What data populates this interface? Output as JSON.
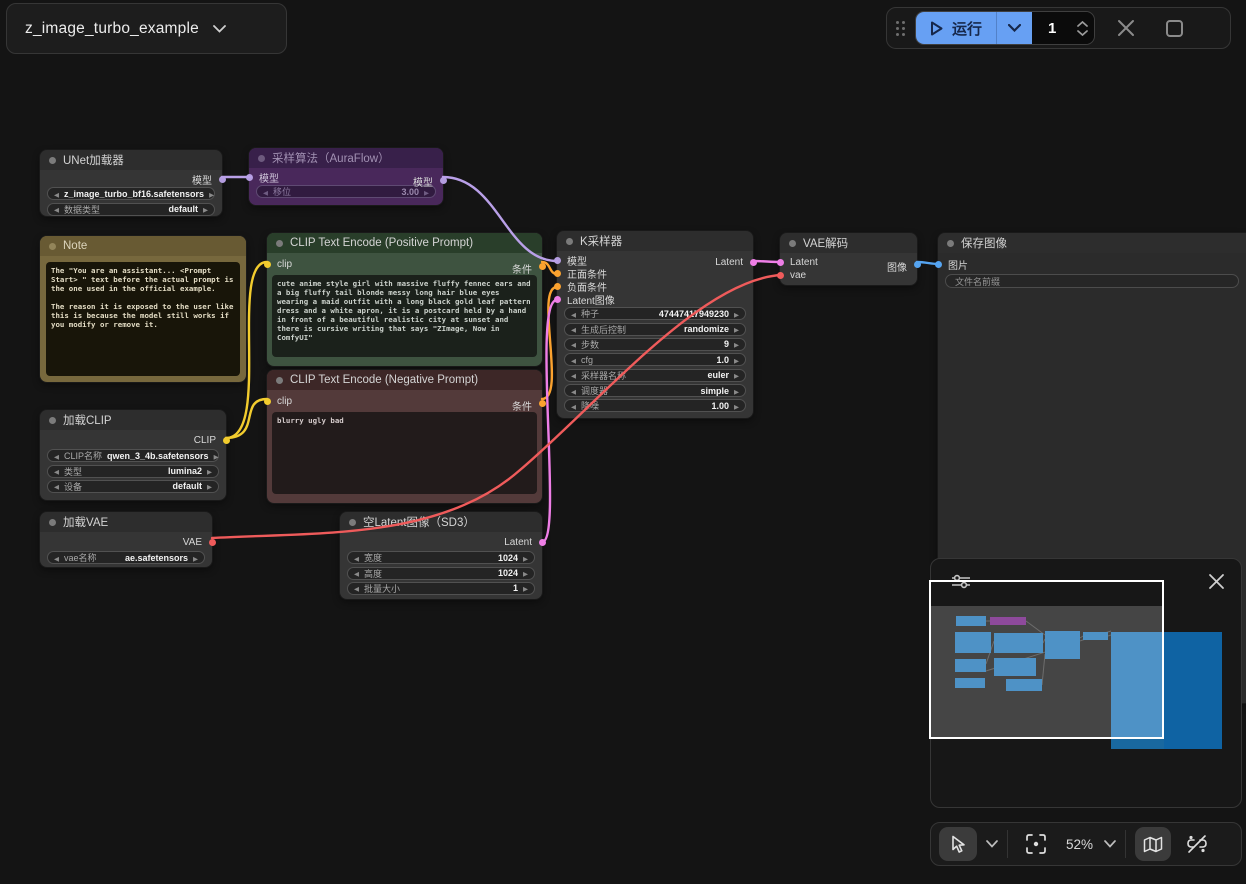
{
  "workflow_tab": {
    "title": "z_image_turbo_example"
  },
  "topbar": {
    "run_label": "运行",
    "batch_count": "1"
  },
  "bottombar": {
    "zoom_level": "52%"
  },
  "colors": {
    "accent_blue": "#67a0f3",
    "wire_model": "#b9a0e8",
    "wire_cond": "#fba22f",
    "wire_clip": "#f2cc2e",
    "wire_latent": "#ee7ee6",
    "wire_vae": "#ef5b5b",
    "wire_image": "#55a4f1",
    "node_green": "#3e5340",
    "node_maroon": "#533a3a",
    "node_olive": "#77683d",
    "node_purple": "#49285b"
  },
  "icons": {
    "play-icon": "▷",
    "chevron-down-icon": "⌄",
    "close-icon": "✕",
    "stop-square-icon": "□",
    "drag-handle-icon": "⣿",
    "cursor-icon": "pointer",
    "fit-view-icon": "[·]",
    "map-icon": "folded-map",
    "link-hidden-icon": "link-slash",
    "sliders-icon": "filters"
  },
  "nodes": {
    "unet": {
      "title": "UNet加载器",
      "output": "模型",
      "widgets": [
        {
          "value": "z_image_turbo_bf16.safetensors"
        },
        {
          "label": "数据类型",
          "value": "default"
        }
      ]
    },
    "aura": {
      "title": "采样算法（AuraFlow）",
      "input": "模型",
      "output": "模型",
      "widgets": [
        {
          "label": "移位",
          "value": "3.00"
        }
      ]
    },
    "note": {
      "title": "Note",
      "text": "The \"You are an assistant... <Prompt Start> \" text before the actual prompt is the one used in the official example.\n\nThe reason it is exposed to the user like this is because the model still works if you modify or remove it."
    },
    "pos": {
      "title": "CLIP Text Encode (Positive Prompt)",
      "input": "clip",
      "output": "条件",
      "text": "cute anime style girl with massive fluffy fennec ears and a big fluffy tail blonde messy long hair blue eyes wearing a maid outfit with a long black gold leaf pattern dress and a white apron, it is a postcard held by a hand in front of a beautiful realistic city at sunset and there is cursive writing that says \"ZImage, Now in ComfyUI\""
    },
    "neg": {
      "title": "CLIP Text Encode (Negative Prompt)",
      "input": "clip",
      "output": "条件",
      "text": "blurry ugly bad"
    },
    "ksampler": {
      "title": "K采样器",
      "inputs": [
        "模型",
        "正面条件",
        "负面条件",
        "Latent图像"
      ],
      "output": "Latent",
      "widgets": [
        {
          "label": "种子",
          "value": "47447417949230"
        },
        {
          "label": "生成后控制",
          "value": "randomize"
        },
        {
          "label": "步数",
          "value": "9"
        },
        {
          "label": "cfg",
          "value": "1.0"
        },
        {
          "label": "采样器名称",
          "value": "euler"
        },
        {
          "label": "调度器",
          "value": "simple"
        },
        {
          "label": "降噪",
          "value": "1.00"
        }
      ]
    },
    "vaedec": {
      "title": "VAE解码",
      "inputs": [
        "Latent",
        "vae"
      ],
      "output": "图像"
    },
    "save": {
      "title": "保存图像",
      "input": "图片",
      "filename_label": "文件名前缀"
    },
    "loadclip": {
      "title": "加载CLIP",
      "output": "CLIP",
      "widgets": [
        {
          "label": "CLIP名称",
          "value": "qwen_3_4b.safetensors"
        },
        {
          "label": "类型",
          "value": "lumina2"
        },
        {
          "label": "设备",
          "value": "default"
        }
      ]
    },
    "loadvae": {
      "title": "加载VAE",
      "output": "VAE",
      "widgets": [
        {
          "label": "vae名称",
          "value": "ae.safetensors"
        }
      ]
    },
    "emptylatent": {
      "title": "空Latent图像（SD3）",
      "output": "Latent",
      "widgets": [
        {
          "label": "宽度",
          "value": "1024"
        },
        {
          "label": "高度",
          "value": "1024"
        },
        {
          "label": "批量大小",
          "value": "1"
        }
      ]
    }
  }
}
